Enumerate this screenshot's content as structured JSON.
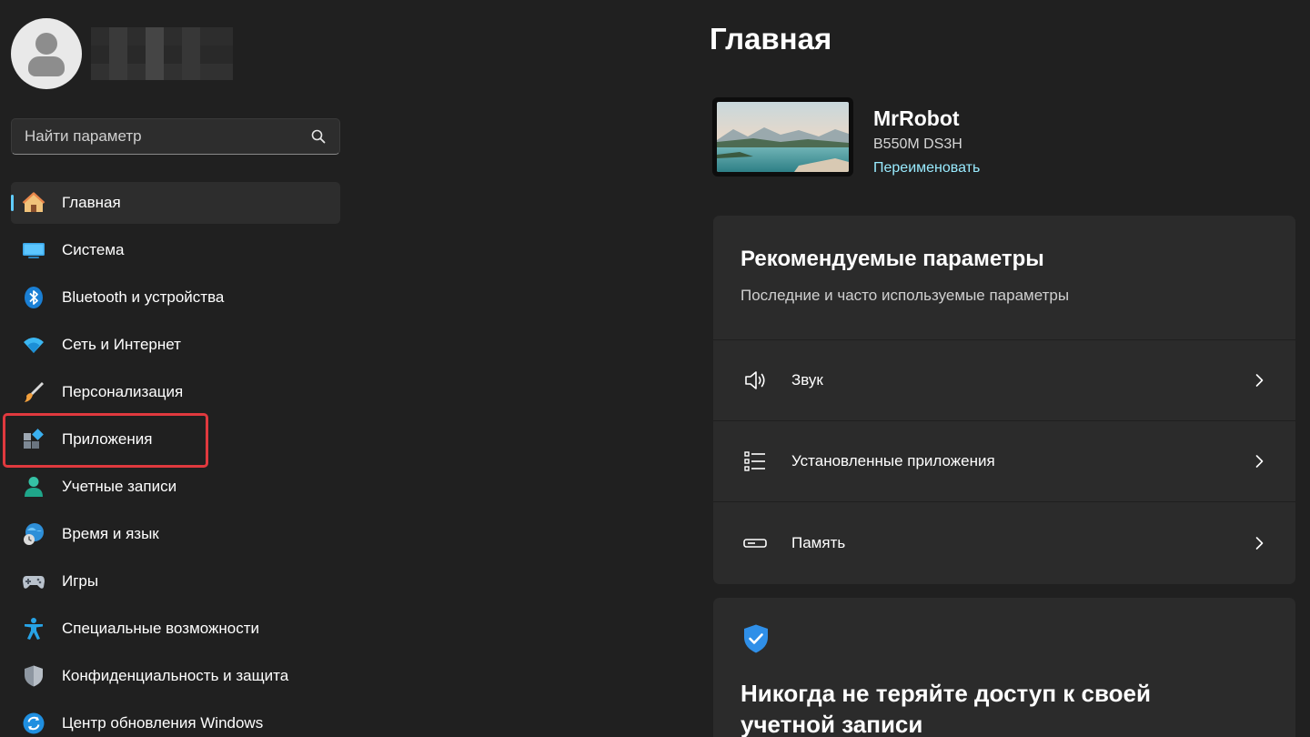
{
  "sidebar": {
    "search": {
      "placeholder": "Найти параметр"
    },
    "items": [
      {
        "label": "Главная",
        "icon": "home-icon",
        "active": true
      },
      {
        "label": "Система",
        "icon": "monitor-icon"
      },
      {
        "label": "Bluetooth и устройства",
        "icon": "bluetooth-icon"
      },
      {
        "label": "Сеть и Интернет",
        "icon": "wifi-icon"
      },
      {
        "label": "Персонализация",
        "icon": "brush-icon"
      },
      {
        "label": "Приложения",
        "icon": "apps-icon",
        "highlighted": true
      },
      {
        "label": "Учетные записи",
        "icon": "person-icon"
      },
      {
        "label": "Время и язык",
        "icon": "globe-clock-icon"
      },
      {
        "label": "Игры",
        "icon": "gamepad-icon"
      },
      {
        "label": "Специальные возможности",
        "icon": "accessibility-icon"
      },
      {
        "label": "Конфиденциальность и защита",
        "icon": "shield-icon"
      },
      {
        "label": "Центр обновления Windows",
        "icon": "update-icon"
      }
    ]
  },
  "main": {
    "title": "Главная",
    "device": {
      "name": "MrRobot",
      "model": "B550M DS3H",
      "rename": "Переименовать"
    },
    "recommended": {
      "title": "Рекомендуемые параметры",
      "subtitle": "Последние и часто используемые параметры",
      "rows": [
        {
          "label": "Звук",
          "icon": "speaker-icon"
        },
        {
          "label": "Установленные приложения",
          "icon": "list-icon"
        },
        {
          "label": "Память",
          "icon": "storage-icon"
        }
      ]
    },
    "account": {
      "title": "Никогда не теряйте доступ к своей учетной записи"
    }
  },
  "colors": {
    "accent": "#60cdff",
    "link": "#99ebff",
    "highlight": "#e0393e",
    "background": "#202020",
    "card": "#2b2b2b"
  }
}
